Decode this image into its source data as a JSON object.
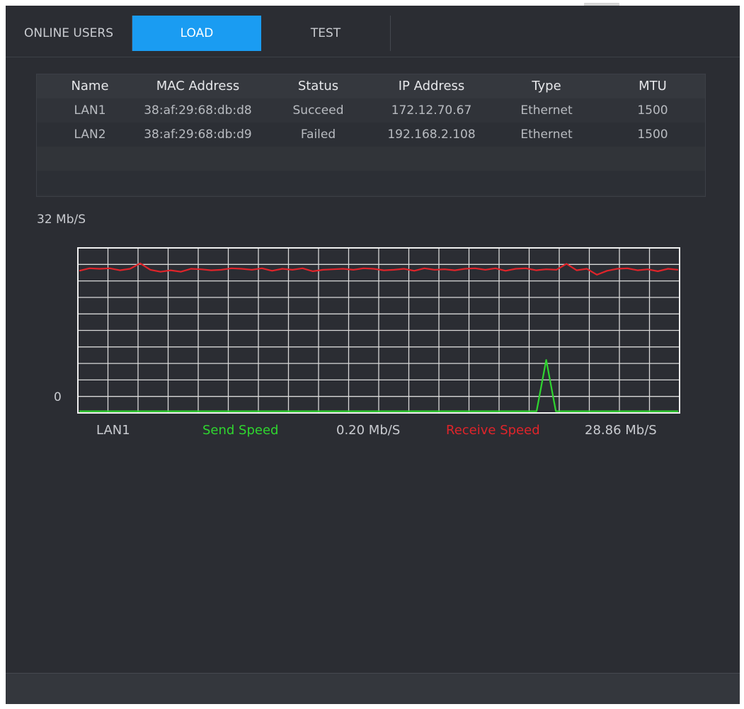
{
  "tabs": [
    {
      "label": "ONLINE USERS",
      "active": false
    },
    {
      "label": "LOAD",
      "active": true
    },
    {
      "label": "TEST",
      "active": false
    }
  ],
  "table": {
    "headers": [
      "Name",
      "MAC Address",
      "Status",
      "IP Address",
      "Type",
      "MTU"
    ],
    "rows": [
      [
        "LAN1",
        "38:af:29:68:db:d8",
        "Succeed",
        "172.12.70.67",
        "Ethernet",
        "1500"
      ],
      [
        "LAN2",
        "38:af:29:68:db:d9",
        "Failed",
        "192.168.2.108",
        "Ethernet",
        "1500"
      ]
    ]
  },
  "chart": {
    "max_label": "32 Mb/S",
    "zero_label": "0",
    "interface": "LAN1",
    "send_label": "Send Speed",
    "send_value": "0.20 Mb/S",
    "receive_label": "Receive Speed",
    "receive_value": "28.86 Mb/S",
    "send_color": "#2fd62f",
    "receive_color": "#e0242a"
  },
  "chart_data": {
    "type": "line",
    "ylim": [
      0,
      32
    ],
    "ylabel_top": "32 Mb/S",
    "series": [
      {
        "name": "Receive Speed",
        "color": "#e0242a",
        "values": [
          28.4,
          28.9,
          28.8,
          28.9,
          28.5,
          28.8,
          29.9,
          28.6,
          28.2,
          28.5,
          28.2,
          28.8,
          28.7,
          28.5,
          28.6,
          28.9,
          28.8,
          28.6,
          28.9,
          28.4,
          28.8,
          28.6,
          28.9,
          28.3,
          28.6,
          28.7,
          28.8,
          28.6,
          28.9,
          28.8,
          28.5,
          28.6,
          28.8,
          28.4,
          28.9,
          28.6,
          28.7,
          28.5,
          28.8,
          28.9,
          28.6,
          28.9,
          28.4,
          28.8,
          28.9,
          28.5,
          28.7,
          28.6,
          29.8,
          28.5,
          28.8,
          27.6,
          28.4,
          28.8,
          28.9,
          28.5,
          28.7,
          28.3,
          28.8,
          28.6
        ]
      },
      {
        "name": "Send Speed",
        "color": "#2fd62f",
        "values": [
          0.2,
          0.2,
          0.2,
          0.2,
          0.2,
          0.2,
          0.2,
          0.2,
          0.2,
          0.2,
          0.2,
          0.2,
          0.2,
          0.2,
          0.2,
          0.2,
          0.2,
          0.2,
          0.2,
          0.2,
          0.2,
          0.2,
          0.2,
          0.2,
          0.2,
          0.2,
          0.2,
          0.2,
          0.2,
          0.2,
          0.2,
          0.2,
          0.2,
          0.2,
          0.2,
          0.2,
          0.2,
          0.2,
          0.2,
          0.2,
          0.2,
          0.2,
          0.2,
          0.2,
          0.2,
          0.2,
          0.2,
          0.2,
          0.2,
          0.2,
          0.2,
          0.2,
          0.2,
          0.2,
          0.2,
          0.2,
          0.2,
          0.2,
          0.2,
          0.2
        ],
        "spike": {
          "index": 46,
          "value": 10.5
        }
      }
    ],
    "grid": true
  }
}
